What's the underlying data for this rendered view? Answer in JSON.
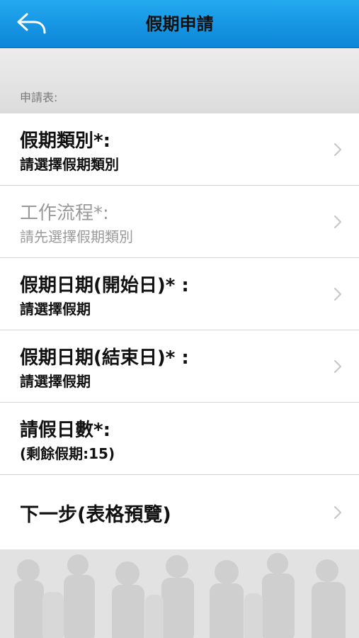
{
  "header": {
    "title": "假期申請",
    "back_icon": "back-arrow-icon"
  },
  "section": {
    "label": "申請表:"
  },
  "form": {
    "rows": [
      {
        "title": "假期類別*:",
        "subtitle": "請選擇假期類別",
        "enabled": true
      },
      {
        "title": "工作流程*:",
        "subtitle": "請先選擇假期類別",
        "enabled": false
      },
      {
        "title": "假期日期(開始日)* :",
        "subtitle": "請選擇假期",
        "enabled": true
      },
      {
        "title": "假期日期(結束日)* :",
        "subtitle": "請選擇假期",
        "enabled": true
      },
      {
        "title": "請假日數*:",
        "subtitle": "(剩餘假期:15)",
        "enabled": true
      },
      {
        "title": "下一步(表格預覽)",
        "subtitle": "",
        "enabled": true
      }
    ]
  },
  "colors": {
    "header_top": "#24a9ef",
    "header_bottom": "#0b85d8",
    "disabled_text": "#9a9a9a",
    "chevron": "#c7c7cc"
  }
}
